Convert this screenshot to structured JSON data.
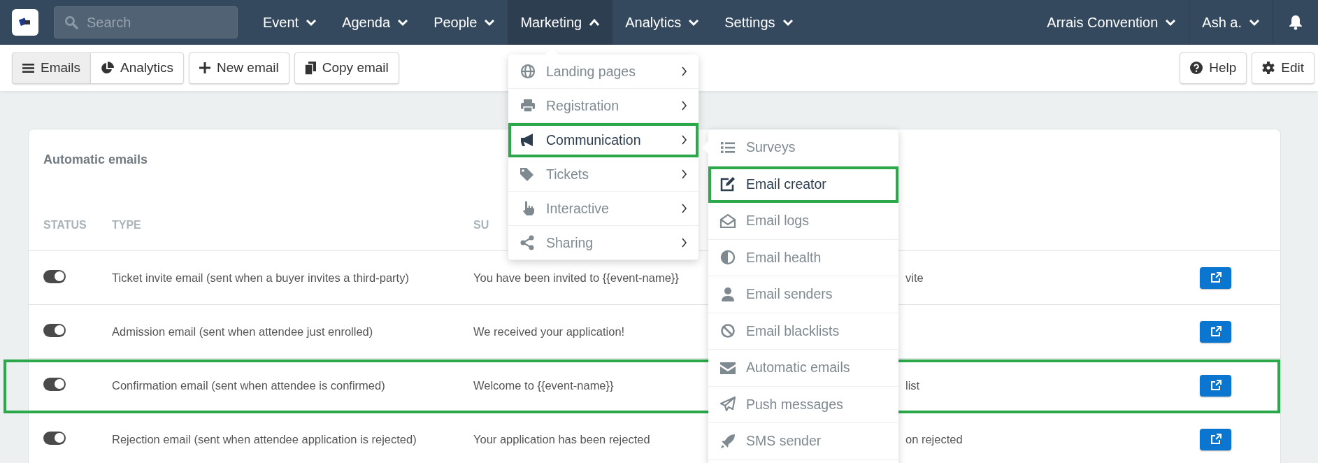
{
  "topbar": {
    "search": {
      "placeholder": "Search"
    },
    "nav": [
      {
        "label": "Event",
        "expanded": false
      },
      {
        "label": "Agenda",
        "expanded": false
      },
      {
        "label": "People",
        "expanded": false
      },
      {
        "label": "Marketing",
        "expanded": true
      },
      {
        "label": "Analytics",
        "expanded": false
      },
      {
        "label": "Settings",
        "expanded": false
      }
    ],
    "event_menu": "Arrais Convention",
    "user_menu": "Ash a."
  },
  "toolbar": {
    "views": [
      {
        "label": "Emails",
        "selected": true
      },
      {
        "label": "Analytics",
        "selected": false
      }
    ],
    "actions": [
      "New email",
      "Copy email"
    ],
    "right_actions": [
      "Help",
      "Edit"
    ]
  },
  "card": {
    "title": "Automatic emails",
    "columns": [
      "STATUS",
      "TYPE",
      "SU"
    ],
    "rows": [
      {
        "on": true,
        "type": "Ticket invite email (sent when a buyer invites a third-party)",
        "subject": "You have been invited to {{event-name}}",
        "column_4": "vite",
        "highlighted": false
      },
      {
        "on": true,
        "type": "Admission email (sent when attendee just enrolled)",
        "subject": "We received your application!",
        "highlighted": false
      },
      {
        "on": true,
        "type": "Confirmation email (sent when attendee is confirmed)",
        "subject": "Welcome to {{event-name}}",
        "column_4": "list",
        "highlighted": true
      },
      {
        "on": true,
        "type": "Rejection email (sent when attendee application is rejected)",
        "subject": "Your application has been rejected",
        "column_4": "on rejected",
        "highlighted": false
      }
    ]
  },
  "marketing_menu": {
    "items": [
      {
        "label": "Landing pages",
        "selected": false,
        "highlighted": false
      },
      {
        "label": "Registration",
        "selected": false,
        "highlighted": false
      },
      {
        "label": "Communication",
        "selected": true,
        "highlighted": true
      },
      {
        "label": "Tickets",
        "selected": false,
        "highlighted": false
      },
      {
        "label": "Interactive",
        "selected": false,
        "highlighted": false
      },
      {
        "label": "Sharing",
        "selected": false,
        "highlighted": false
      }
    ]
  },
  "communication_menu": {
    "items": [
      {
        "label": "Surveys",
        "selected": false,
        "highlighted": false
      },
      {
        "label": "Email creator",
        "selected": true,
        "highlighted": true
      },
      {
        "label": "Email logs",
        "selected": false,
        "highlighted": false
      },
      {
        "label": "Email health",
        "selected": false,
        "highlighted": false
      },
      {
        "label": "Email senders",
        "selected": false,
        "highlighted": false
      },
      {
        "label": "Email blacklists",
        "selected": false,
        "highlighted": false
      },
      {
        "label": "Automatic emails",
        "selected": false,
        "highlighted": false
      },
      {
        "label": "Push messages",
        "selected": false,
        "highlighted": false
      },
      {
        "label": "SMS sender",
        "selected": false,
        "highlighted": false
      }
    ]
  }
}
